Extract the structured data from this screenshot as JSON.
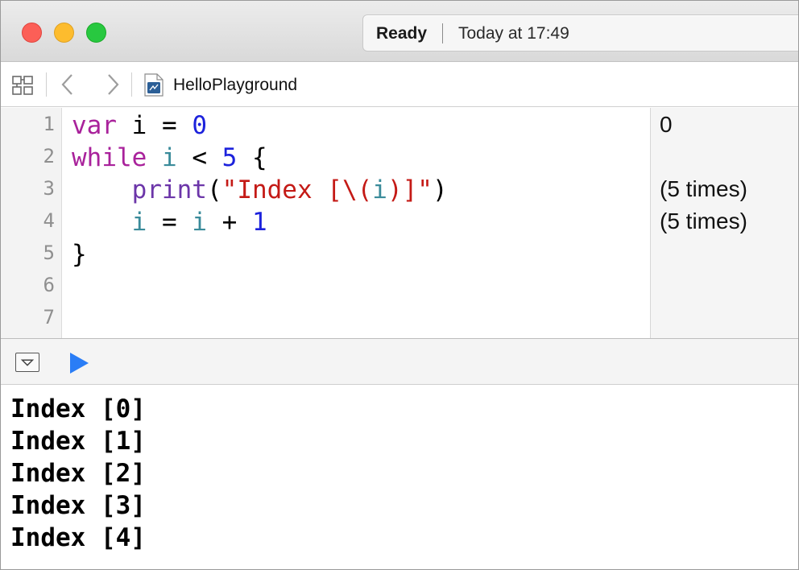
{
  "window": {
    "activity": {
      "status": "Ready",
      "time": "Today at 17:49"
    }
  },
  "jumpbar": {
    "file_name": "HelloPlayground"
  },
  "editor": {
    "line_numbers": [
      "1",
      "2",
      "3",
      "4",
      "5",
      "6",
      "7"
    ],
    "code_lines": [
      [
        {
          "t": "var",
          "c": "kw"
        },
        {
          "t": " i = ",
          "c": ""
        },
        {
          "t": "0",
          "c": "num"
        }
      ],
      [
        {
          "t": "while",
          "c": "kw"
        },
        {
          "t": " ",
          "c": ""
        },
        {
          "t": "i",
          "c": "var"
        },
        {
          "t": " < ",
          "c": ""
        },
        {
          "t": "5",
          "c": "num"
        },
        {
          "t": " {",
          "c": ""
        }
      ],
      [
        {
          "t": "    ",
          "c": ""
        },
        {
          "t": "print",
          "c": "fn"
        },
        {
          "t": "(",
          "c": ""
        },
        {
          "t": "\"Index [\\(",
          "c": "str"
        },
        {
          "t": "i",
          "c": "var"
        },
        {
          "t": ")]\"",
          "c": "str"
        },
        {
          "t": ")",
          "c": ""
        }
      ],
      [
        {
          "t": "    ",
          "c": ""
        },
        {
          "t": "i",
          "c": "var"
        },
        {
          "t": " = ",
          "c": ""
        },
        {
          "t": "i",
          "c": "var"
        },
        {
          "t": " + ",
          "c": ""
        },
        {
          "t": "1",
          "c": "num"
        }
      ],
      [
        {
          "t": "}",
          "c": ""
        }
      ],
      [],
      []
    ],
    "results": [
      "0",
      "",
      "(5 times)",
      "(5 times)",
      "",
      "",
      ""
    ]
  },
  "console": {
    "lines": [
      "Index [0]",
      "Index [1]",
      "Index [2]",
      "Index [3]",
      "Index [4]"
    ]
  },
  "colors": {
    "keyword": "#a9229b",
    "number": "#1c22dc",
    "variable": "#3a8b9a",
    "function": "#6c36a9",
    "string": "#c41a16",
    "play": "#2a7df6"
  },
  "icons": {
    "close": "close-button",
    "minimize": "minimize-button",
    "zoom": "zoom-button",
    "related_items": "grid-icon",
    "back": "chevron-left-icon",
    "forward": "chevron-right-icon",
    "file": "playground-file-icon",
    "hide_debug": "hide-debug-area-icon",
    "run": "play-icon"
  }
}
